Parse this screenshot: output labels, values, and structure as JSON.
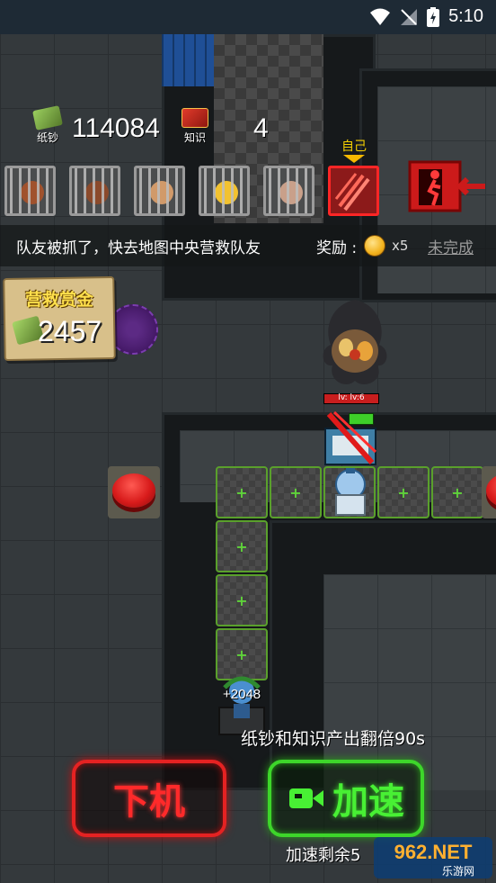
{
  "status_bar": {
    "time": "5:10"
  },
  "resources": {
    "cash_label": "纸钞",
    "cash_value": "114084",
    "knowledge_label": "知识",
    "knowledge_value": "4"
  },
  "slots": {
    "self_label": "自己",
    "items": [
      {
        "name": "caged-teammate-1",
        "color": "#a0522d"
      },
      {
        "name": "caged-teammate-2",
        "color": "#8b4a2b"
      },
      {
        "name": "caged-teammate-3",
        "color": "#d19a6a"
      },
      {
        "name": "caged-teammate-4",
        "color": "#f2c230"
      },
      {
        "name": "caged-teammate-5",
        "color": "#c9a08a"
      },
      {
        "name": "self-slot",
        "color": "#d83a2e"
      }
    ]
  },
  "task": {
    "text": "队友被抓了，快去地图中央营救队友",
    "reward_label": "奖励 :",
    "reward_count": "x5",
    "status": "未完成"
  },
  "bounty": {
    "title": "营救赏金",
    "value": "2457"
  },
  "enemy": {
    "hp_text": "lv:   lv:6"
  },
  "gain": {
    "text": "+2048"
  },
  "boost_info": "纸钞和知识产出翻倍90s",
  "buttons": {
    "leave": "下机",
    "speed": "加速"
  },
  "remain_text": "加速剩余5",
  "watermark": {
    "line1": "962.NET",
    "line2": "乐游网"
  },
  "colors": {
    "leave": "#e52222",
    "speed": "#3dd62a",
    "task_pending": "#9a9a9a"
  }
}
